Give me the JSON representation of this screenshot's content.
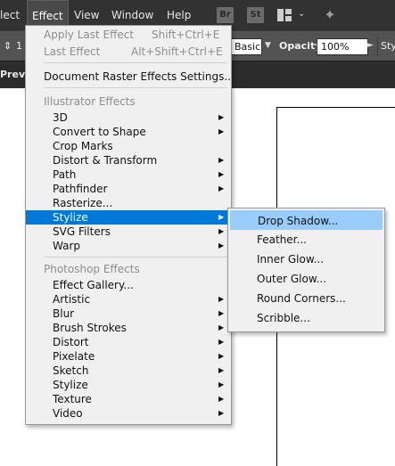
{
  "app": {
    "menus": [
      "lect",
      "Effect",
      "View",
      "Window",
      "Help"
    ],
    "bridge_icon": "Br",
    "stock_icon": "St",
    "workspace_icon": "workspace-grid-icon",
    "gpu_icon": "gpu-performance-icon"
  },
  "controlbar": {
    "stroke_value": "1",
    "style_value": "Basic",
    "opacity_label": "Opacity:",
    "opacity_value": "100%",
    "style_label": "Sty"
  },
  "tab": {
    "label": "Previe"
  },
  "effect_menu": {
    "apply_last_effect": {
      "label": "Apply Last Effect",
      "shortcut": "Shift+Ctrl+E"
    },
    "last_effect": {
      "label": "Last Effect",
      "shortcut": "Alt+Shift+Ctrl+E"
    },
    "document_raster_settings": "Document Raster Effects Settings...",
    "illustrator_header": "Illustrator Effects",
    "illustrator_items": [
      "3D",
      "Convert to Shape",
      "Crop Marks",
      "Distort & Transform",
      "Path",
      "Pathfinder",
      "Rasterize...",
      "Stylize",
      "SVG Filters",
      "Warp"
    ],
    "photoshop_header": "Photoshop Effects",
    "photoshop_items": [
      "Effect Gallery...",
      "Artistic",
      "Blur",
      "Brush Strokes",
      "Distort",
      "Pixelate",
      "Sketch",
      "Stylize",
      "Texture",
      "Video"
    ]
  },
  "stylize_submenu": {
    "items": [
      "Drop Shadow...",
      "Feather...",
      "Inner Glow...",
      "Outer Glow...",
      "Round Corners...",
      "Scribble..."
    ]
  },
  "colors": {
    "menubar_bg": "#323232",
    "menu_bg": "#f0f0f0",
    "menu_highlight": "#0078d7",
    "submenu_highlight": "#99ccf8",
    "disabled_text": "#8d8d8d"
  }
}
